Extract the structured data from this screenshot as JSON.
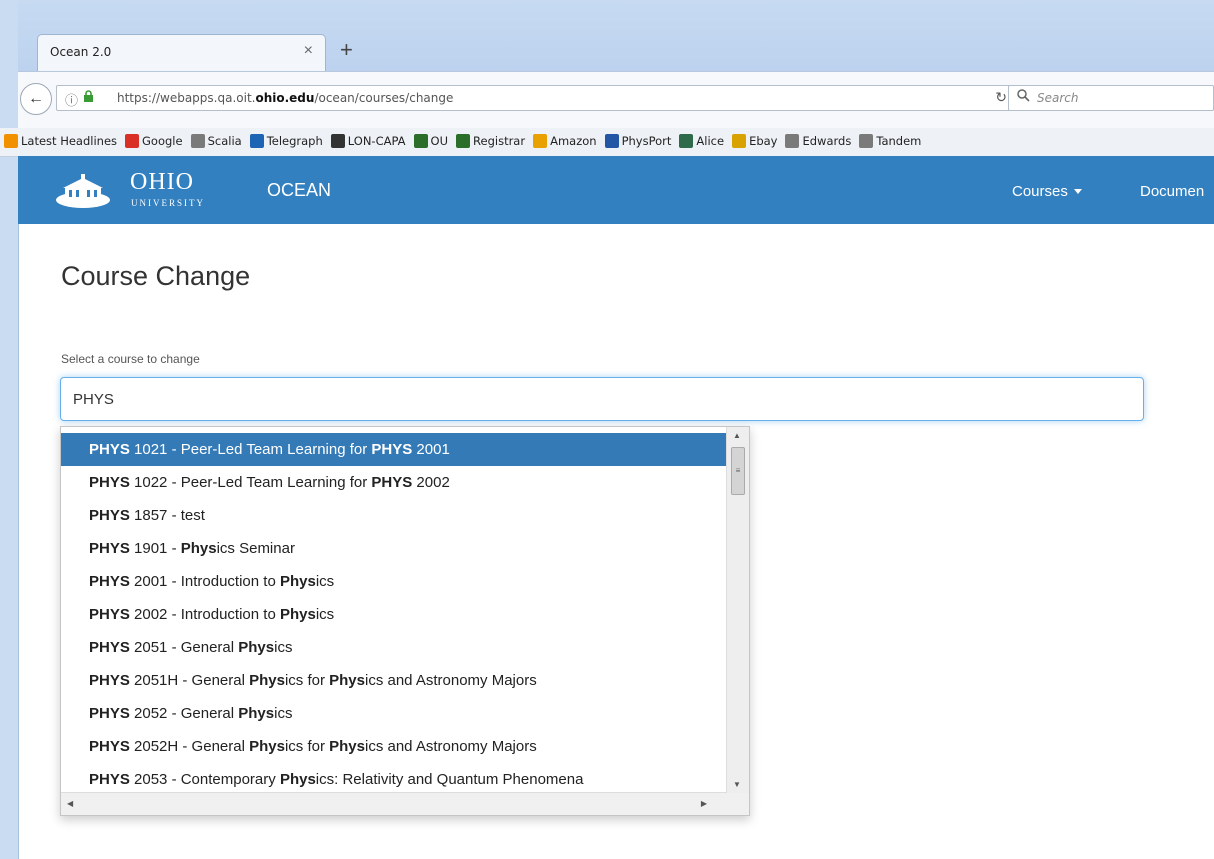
{
  "browser": {
    "tab_title": "Ocean 2.0",
    "url_host_prefix": "https://webapps.qa.oit.",
    "url_host_bold": "ohio.edu",
    "url_path": "/ocean/courses/change",
    "search_placeholder": "Search",
    "bookmarks": [
      {
        "label": "Latest Headlines",
        "icon": "rss-icon",
        "color": "#f29100"
      },
      {
        "label": "Google",
        "icon": "gmail-icon",
        "color": "#d93025"
      },
      {
        "label": "Scalia",
        "icon": "globe-icon",
        "color": "#7a7a7a"
      },
      {
        "label": "Telegraph",
        "icon": "telegraph-icon",
        "color": "#1e64b4"
      },
      {
        "label": "LON-CAPA",
        "icon": "loncapa-icon",
        "color": "#333333"
      },
      {
        "label": "OU",
        "icon": "ohio-icon",
        "color": "#2a6e2a"
      },
      {
        "label": "Registrar",
        "icon": "ohio-icon",
        "color": "#2a6e2a"
      },
      {
        "label": "Amazon",
        "icon": "amazon-icon",
        "color": "#e8a100"
      },
      {
        "label": "PhysPort",
        "icon": "physport-icon",
        "color": "#2456a6"
      },
      {
        "label": "Alice",
        "icon": "alice-icon",
        "color": "#2d6b4a"
      },
      {
        "label": "Ebay",
        "icon": "gift-icon",
        "color": "#d8a200"
      },
      {
        "label": "Edwards",
        "icon": "globe-icon",
        "color": "#7a7a7a"
      },
      {
        "label": "Tandem",
        "icon": "globe-icon",
        "color": "#7a7a7a"
      }
    ]
  },
  "app_nav": {
    "logo_ohio": "OHIO",
    "logo_university": "UNIVERSITY",
    "brand": "OCEAN",
    "courses_menu": "Courses",
    "documents_menu": "Documen"
  },
  "page": {
    "title": "Course Change",
    "field_label": "Select a course to change",
    "search_value": "PHYS"
  },
  "suggestions": [
    {
      "parts": [
        {
          "b": "PHYS"
        },
        {
          "t": " 1021 - Peer-Led Team Learning for "
        },
        {
          "b": "PHYS"
        },
        {
          "t": " 2001"
        }
      ],
      "active": true
    },
    {
      "parts": [
        {
          "b": "PHYS"
        },
        {
          "t": " 1022 - Peer-Led Team Learning for "
        },
        {
          "b": "PHYS"
        },
        {
          "t": " 2002"
        }
      ]
    },
    {
      "parts": [
        {
          "b": "PHYS"
        },
        {
          "t": " 1857 - test"
        }
      ]
    },
    {
      "parts": [
        {
          "b": "PHYS"
        },
        {
          "t": " 1901 - "
        },
        {
          "b": "Phys"
        },
        {
          "t": "ics Seminar"
        }
      ]
    },
    {
      "parts": [
        {
          "b": "PHYS"
        },
        {
          "t": " 2001 - Introduction to "
        },
        {
          "b": "Phys"
        },
        {
          "t": "ics"
        }
      ]
    },
    {
      "parts": [
        {
          "b": "PHYS"
        },
        {
          "t": " 2002 - Introduction to "
        },
        {
          "b": "Phys"
        },
        {
          "t": "ics"
        }
      ]
    },
    {
      "parts": [
        {
          "b": "PHYS"
        },
        {
          "t": " 2051 - General "
        },
        {
          "b": "Phys"
        },
        {
          "t": "ics"
        }
      ]
    },
    {
      "parts": [
        {
          "b": "PHYS"
        },
        {
          "t": " 2051H - General "
        },
        {
          "b": "Phys"
        },
        {
          "t": "ics for "
        },
        {
          "b": "Phys"
        },
        {
          "t": "ics and Astronomy Majors"
        }
      ]
    },
    {
      "parts": [
        {
          "b": "PHYS"
        },
        {
          "t": " 2052 - General "
        },
        {
          "b": "Phys"
        },
        {
          "t": "ics"
        }
      ]
    },
    {
      "parts": [
        {
          "b": "PHYS"
        },
        {
          "t": " 2052H - General "
        },
        {
          "b": "Phys"
        },
        {
          "t": "ics for "
        },
        {
          "b": "Phys"
        },
        {
          "t": "ics and Astronomy Majors"
        }
      ]
    },
    {
      "parts": [
        {
          "b": "PHYS"
        },
        {
          "t": " 2053 - Contemporary "
        },
        {
          "b": "Phys"
        },
        {
          "t": "ics: Relativity and Quantum Phenomena"
        }
      ]
    }
  ]
}
